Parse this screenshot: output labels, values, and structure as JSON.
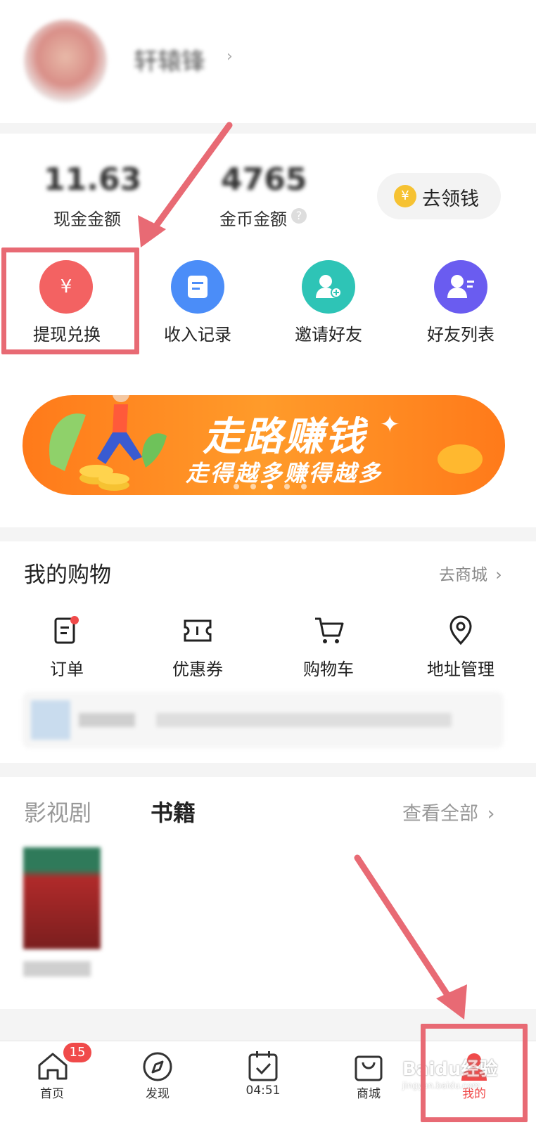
{
  "profile": {
    "name": "轩辕锋"
  },
  "wallet": {
    "cash_value": "11.63",
    "cash_label": "现金金额",
    "coin_value": "4765",
    "coin_label": "金币金额",
    "claim_button": "去领钱"
  },
  "actions": [
    {
      "label": "提现兑换"
    },
    {
      "label": "收入记录"
    },
    {
      "label": "邀请好友"
    },
    {
      "label": "好友列表"
    }
  ],
  "banner": {
    "title": "走路赚钱",
    "subtitle": "走得越多赚得越多"
  },
  "shopping": {
    "title": "我的购物",
    "link": "去商城",
    "items": [
      {
        "label": "订单"
      },
      {
        "label": "优惠券"
      },
      {
        "label": "购物车"
      },
      {
        "label": "地址管理"
      }
    ]
  },
  "media": {
    "tab_video": "影视剧",
    "tab_books": "书籍",
    "see_all": "查看全部"
  },
  "tabbar": {
    "items": [
      {
        "label": "首页"
      },
      {
        "label": "发现"
      },
      {
        "label": "04:51"
      },
      {
        "label": "商城"
      },
      {
        "label": "我的"
      }
    ],
    "home_badge": "15"
  },
  "watermark": "Baidu经验",
  "watermark_url": "jingyan.baidu.com",
  "colors": {
    "accent_red": "#f04a4a",
    "arrow": "#e86a74",
    "banner_orange": "#ff8a1e"
  }
}
